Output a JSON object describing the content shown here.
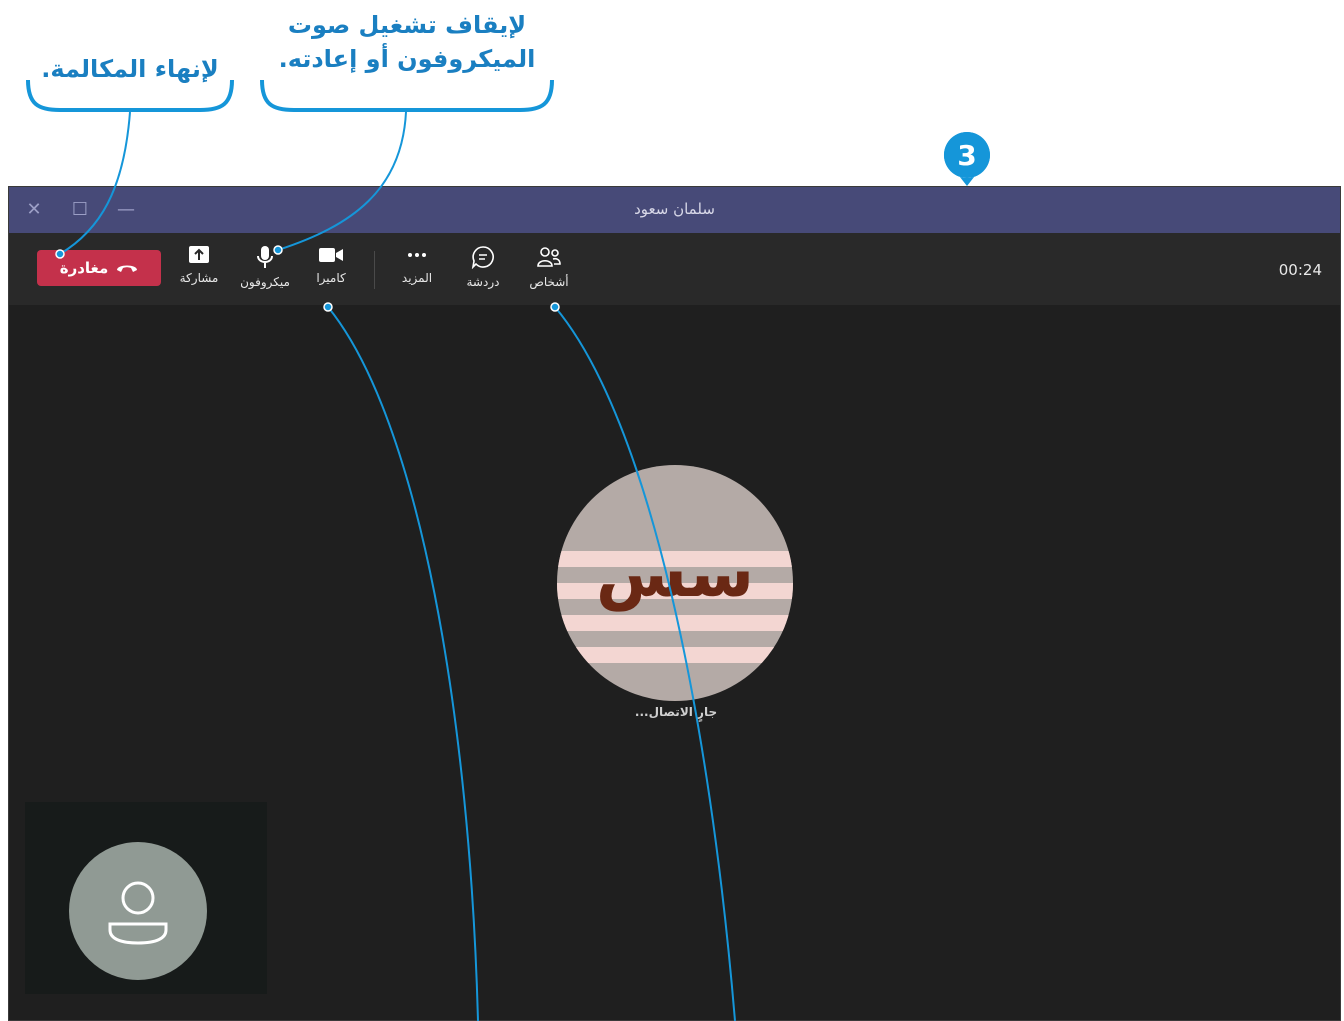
{
  "annotations": {
    "end_call": "لإنهاء المكالمة.",
    "mic_line1": "لإيقاف تشغيل صوت",
    "mic_line2": "الميكروفون أو إعادته.",
    "step_number": "3"
  },
  "window": {
    "title": "سلمان سعود",
    "controls": {
      "close": "✕",
      "maximize": "☐",
      "minimize": "—"
    }
  },
  "toolbar": {
    "leave_label": "مغادرة",
    "share_label": "مشاركة",
    "mic_label": "ميكروفون",
    "camera_label": "كاميرا",
    "more_label": "المزيد",
    "chat_label": "دردشة",
    "people_label": "أشخاص",
    "timer": "00:24"
  },
  "call": {
    "remote_initials": "سس",
    "status": "جارٍ الاتصال..."
  },
  "colors": {
    "titlebar": "#474a78",
    "leave_button": "#c4314b",
    "callout_accent": "#1a7fc1"
  },
  "icons": [
    "hangup-icon",
    "share-screen-icon",
    "microphone-icon",
    "camera-icon",
    "more-icon",
    "chat-icon",
    "people-icon",
    "person-icon"
  ]
}
